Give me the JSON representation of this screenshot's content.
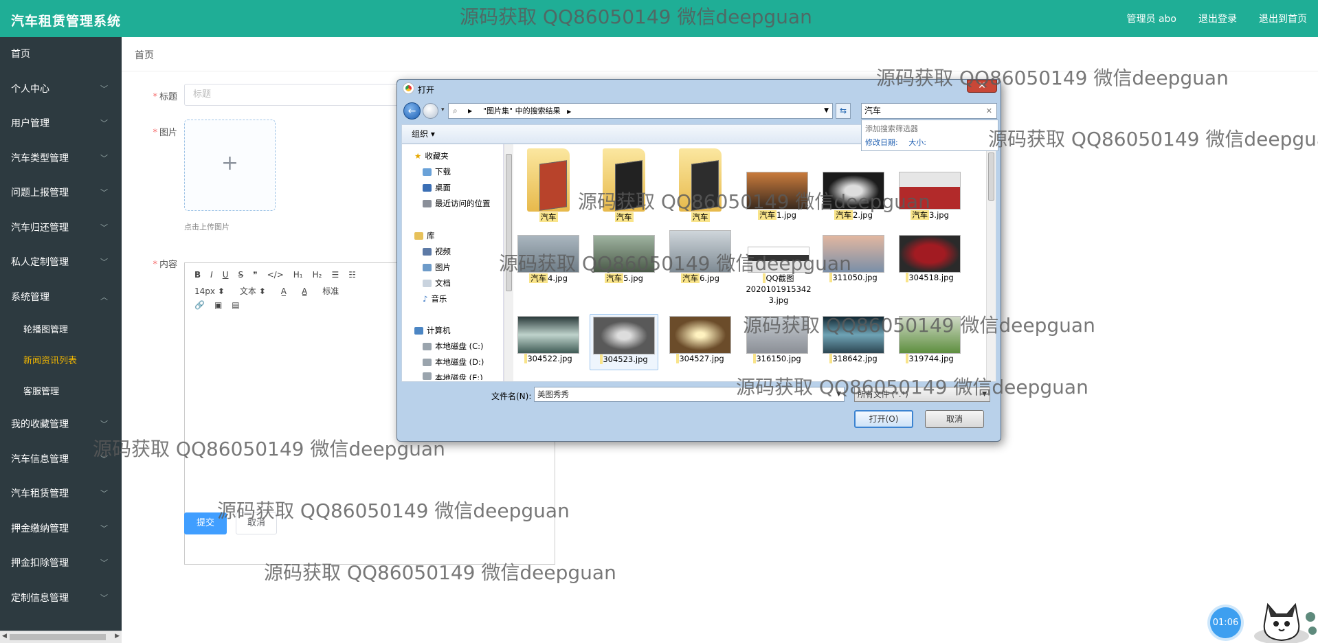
{
  "app": {
    "title": "汽车租赁管理系统"
  },
  "header": {
    "admin": "管理员 abo",
    "logout": "退出登录",
    "home": "退出到首页"
  },
  "sidebar": {
    "items": [
      {
        "label": "首页",
        "chev": ""
      },
      {
        "label": "个人中心",
        "chev": "﹀"
      },
      {
        "label": "用户管理",
        "chev": "﹀"
      },
      {
        "label": "汽车类型管理",
        "chev": "﹀"
      },
      {
        "label": "问题上报管理",
        "chev": "﹀"
      },
      {
        "label": "汽车归还管理",
        "chev": "﹀"
      },
      {
        "label": "私人定制管理",
        "chev": "﹀"
      },
      {
        "label": "系统管理",
        "chev": "︿"
      }
    ],
    "sub": [
      {
        "label": "轮播图管理"
      },
      {
        "label": "新闻资讯列表"
      },
      {
        "label": "客服管理"
      }
    ],
    "items2": [
      {
        "label": "我的收藏管理",
        "chev": "﹀"
      },
      {
        "label": "汽车信息管理",
        "chev": "﹀"
      },
      {
        "label": "汽车租赁管理",
        "chev": "﹀"
      },
      {
        "label": "押金缴纳管理",
        "chev": "﹀"
      },
      {
        "label": "押金扣除管理",
        "chev": "﹀"
      },
      {
        "label": "定制信息管理",
        "chev": "﹀"
      }
    ]
  },
  "breadcrumb": "首页",
  "form": {
    "title_label": "标题",
    "title_placeholder": "标题",
    "image_label": "图片",
    "upload_hint": "点击上传图片",
    "content_label": "内容",
    "submit": "提交",
    "cancel": "取消",
    "editor": {
      "row1": [
        "B",
        "I",
        "U",
        "S",
        "❞",
        "</>",
        "H₁",
        "H₂",
        "☰",
        "☷"
      ],
      "font_size": "14px",
      "font_type": "文本",
      "heading": "标准"
    }
  },
  "dialog": {
    "title": "打开",
    "address": "\"图片集\" 中的搜索结果",
    "search_value": "汽车",
    "suggest_title": "添加搜索筛选器",
    "suggest_date": "修改日期:",
    "suggest_size": "大小:",
    "organize": "组织 ▾",
    "tree": {
      "favorites": "收藏夹",
      "download": "下载",
      "desktop": "桌面",
      "recent": "最近访问的位置",
      "library": "库",
      "video": "视频",
      "pictures": "图片",
      "docs": "文档",
      "music": "音乐",
      "computer": "计算机",
      "disk_c": "本地磁盘 (C:)",
      "disk_d": "本地磁盘 (D:)",
      "disk_e": "本地磁盘 (E:)"
    },
    "files": [
      {
        "name_hl": "汽车",
        "name_rest": "",
        "kind": "folder",
        "color": "#b8432b"
      },
      {
        "name_hl": "汽车",
        "name_rest": "",
        "kind": "folder",
        "color": "#222222"
      },
      {
        "name_hl": "汽车",
        "name_rest": "",
        "kind": "folder",
        "color": "#2d2d2d"
      },
      {
        "name_hl": "汽车",
        "name_rest": "1.jpg",
        "kind": "image",
        "color": "#3a2a1e"
      },
      {
        "name_hl": "汽车",
        "name_rest": "2.jpg",
        "kind": "image",
        "color": "#1b1b1b"
      },
      {
        "name_hl": "汽车",
        "name_rest": "3.jpg",
        "kind": "image",
        "color": "#b22a2a"
      },
      {
        "name_hl": "汽车",
        "name_rest": "4.jpg",
        "kind": "image",
        "color": "#6f7d87"
      },
      {
        "name_hl": "汽车",
        "name_rest": "5.jpg",
        "kind": "image",
        "color": "#4a5a48"
      },
      {
        "name_hl": "汽车",
        "name_rest": "6.jpg",
        "kind": "image",
        "color": "#7e8a93"
      },
      {
        "name_hl": "",
        "name_rest": "QQ截图2020101915342 3.jpg",
        "kind": "image",
        "color": "#e3e3e3"
      },
      {
        "name_hl": "",
        "name_rest": "311050.jpg",
        "kind": "image",
        "color": "#7a8fa8"
      },
      {
        "name_hl": "",
        "name_rest": "304518.jpg",
        "kind": "image",
        "color": "#a21b22"
      },
      {
        "name_hl": "",
        "name_rest": "304522.jpg",
        "kind": "image",
        "color": "#3f5b55"
      },
      {
        "name_hl": "",
        "name_rest": "304523.jpg",
        "kind": "image",
        "color": "#595959"
      },
      {
        "name_hl": "",
        "name_rest": "304527.jpg",
        "kind": "image",
        "color": "#6b4c2a"
      },
      {
        "name_hl": "",
        "name_rest": "316150.jpg",
        "kind": "image",
        "color": "#8b8f96"
      },
      {
        "name_hl": "",
        "name_rest": "318642.jpg",
        "kind": "image",
        "color": "#2c4652"
      },
      {
        "name_hl": "",
        "name_rest": "319744.jpg",
        "kind": "image",
        "color": "#5e8f3f"
      }
    ],
    "filename_label": "文件名(N):",
    "filename_value": "美图秀秀",
    "filetype": "所有文件 (*.*)",
    "open": "打开(O)",
    "cancel": "取消"
  },
  "watermark": "源码获取 QQ86050149 微信deepguan",
  "timer": "01:06",
  "colors": {
    "topbar": "#1fae96",
    "sidebar": "#2d3a40",
    "active": "#f1b600",
    "primary": "#409eff"
  }
}
